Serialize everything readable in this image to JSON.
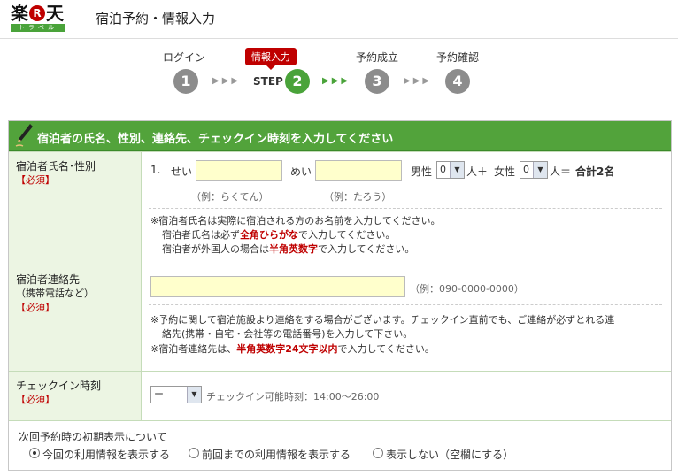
{
  "logo": {
    "kanji_left": "楽",
    "r_mark": "R",
    "kanji_right": "天",
    "sub": "トラベル"
  },
  "header": {
    "title": "宿泊予約・情報入力"
  },
  "steps": {
    "items": [
      {
        "label": "ログイン",
        "number": "1"
      },
      {
        "label": "情報入力",
        "number": "2",
        "prefix": "STEP"
      },
      {
        "label": "予約成立",
        "number": "3"
      },
      {
        "label": "予約確認",
        "number": "4"
      }
    ],
    "arrows": "▶▶▶",
    "active_index": 1,
    "active_color": "#4aa33a",
    "inactive_color": "#8c8c8c"
  },
  "form": {
    "section_title": "宿泊者の氏名、性別、連絡先、チェックイン時刻を入力してください",
    "name_row": {
      "label": "宿泊者氏名･性別",
      "required": "【必須】",
      "index": "1.",
      "sei_label": "せい",
      "sei_value": "",
      "sei_hint": "（例：らくてん）",
      "mei_label": "めい",
      "mei_value": "",
      "mei_hint": "（例：たろう）",
      "male_label": "男性",
      "male_count": "0",
      "male_suffix": "人＋",
      "female_label": "女性",
      "female_count": "0",
      "female_suffix": "人＝",
      "total": "合計2名",
      "note1": "※宿泊者氏名は実際に宿泊される方のお名前を入力してください。",
      "note2_pre": "宿泊者氏名は必ず",
      "note2_em": "全角ひらがな",
      "note2_post": "で入力してください。",
      "note3_pre": "宿泊者が外国人の場合は",
      "note3_em": "半角英数字",
      "note3_post": "で入力してください。"
    },
    "contact_row": {
      "label1": "宿泊者連絡先",
      "label2": "（携帯電話など）",
      "required": "【必須】",
      "phone_value": "",
      "phone_hint": "（例：090-0000-0000）",
      "note1": "※予約に関して宿泊施設より連絡をする場合がございます。チェックイン直前でも、ご連絡が必ずとれる連",
      "note2": "絡先(携帯・自宅・会社等の電話番号)を入力して下さい。",
      "note3_pre": "※宿泊者連絡先は、",
      "note3_em": "半角英数字24文字以内",
      "note3_post": "で入力してください。"
    },
    "checkin_row": {
      "label": "チェックイン時刻",
      "required": "【必須】",
      "selected": "ー",
      "hint": "チェックイン可能時刻：14:00～26:00"
    },
    "default_display": {
      "title": "次回予約時の初期表示について",
      "options": [
        {
          "label": "今回の利用情報を表示する",
          "checked": true
        },
        {
          "label": "前回までの利用情報を表示する",
          "checked": false
        },
        {
          "label": "表示しない（空欄にする）",
          "checked": false
        }
      ]
    }
  }
}
